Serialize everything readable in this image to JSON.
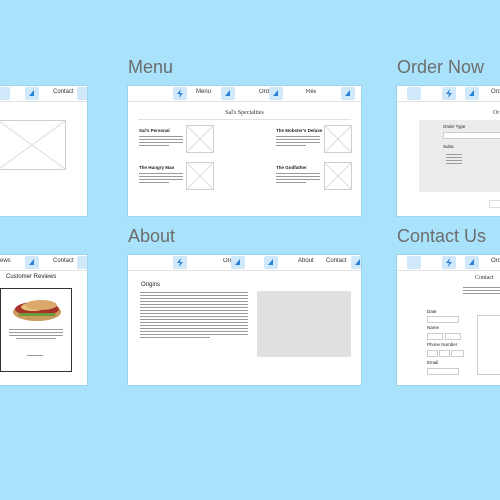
{
  "titles": {
    "menu": "Menu",
    "order_now": "Order Now",
    "about": "About",
    "contact_us": "Contact Us"
  },
  "nav": {
    "menu": "Menu",
    "order": "Order",
    "about": "About",
    "contact": "Contact",
    "reviews": "Reviews"
  },
  "menu_page": {
    "heading": "Sal's Specialties",
    "items": [
      "Sal's Personal",
      "The Mobster's Deluxe",
      "The Hungry Man",
      "The Godfather"
    ]
  },
  "order_page": {
    "heading": "Or",
    "order_type_label": "Order Type",
    "subs_label": "Subs:"
  },
  "reviews_page": {
    "heading": "Customer Reviews"
  },
  "about_page": {
    "heading": "Origins"
  },
  "contact_page": {
    "heading": "Contact",
    "date_label": "Date",
    "name_label": "Name",
    "phone_label": "Phone Number",
    "email_label": "Email"
  },
  "colors": {
    "background": "#a8e2fb",
    "logo_tile": "#cfe9fb",
    "logo_bolt": "#2b7fd4"
  },
  "icons": [
    "lightning-bolt-icon",
    "shark-fin-icon",
    "image-placeholder-icon"
  ]
}
